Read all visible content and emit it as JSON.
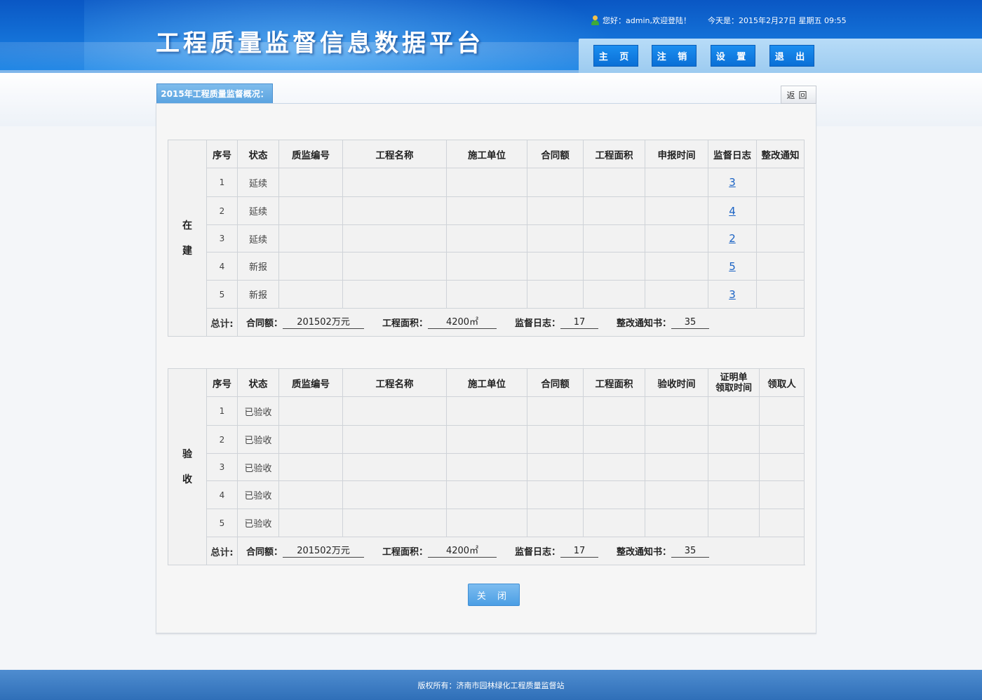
{
  "header": {
    "title": "工程质量监督信息数据平台",
    "greeting": "您好：admin,欢迎登陆！",
    "today": "今天是：2015年2月27日 星期五 09:55"
  },
  "nav": [
    {
      "label": "主 页"
    },
    {
      "label": "注 销"
    },
    {
      "label": "设 置"
    },
    {
      "label": "退 出"
    }
  ],
  "section": {
    "tab_title": "2015年工程质量监督概况：",
    "back_label": "返回"
  },
  "building": {
    "side_label_1": "在",
    "side_label_2": "建",
    "headers": [
      "序号",
      "状态",
      "质监编号",
      "工程名称",
      "施工单位",
      "合同额",
      "工程面积",
      "申报时间",
      "监督日志",
      "整改通知"
    ],
    "rows": [
      {
        "idx": "1",
        "status": "延续",
        "log": "3"
      },
      {
        "idx": "2",
        "status": "延续",
        "log": "4"
      },
      {
        "idx": "3",
        "status": "延续",
        "log": "2"
      },
      {
        "idx": "4",
        "status": "新报",
        "log": "5"
      },
      {
        "idx": "5",
        "status": "新报",
        "log": "3"
      }
    ],
    "total": {
      "label": "总计:",
      "contract_label": "合同额：",
      "contract_value": "201502万元",
      "area_label": "工程面积：",
      "area_value": "4200㎡",
      "log_label": "监督日志：",
      "log_value": "17",
      "notice_label": "整改通知书：",
      "notice_value": "35"
    }
  },
  "accepted": {
    "side_label_1": "验",
    "side_label_2": "收",
    "headers": [
      "序号",
      "状态",
      "质监编号",
      "工程名称",
      "施工单位",
      "合同额",
      "工程面积",
      "验收时间",
      "证明单",
      "领取时间",
      "领取人"
    ],
    "rows": [
      {
        "idx": "1",
        "status": "已验收"
      },
      {
        "idx": "2",
        "status": "已验收"
      },
      {
        "idx": "3",
        "status": "已验收"
      },
      {
        "idx": "4",
        "status": "已验收"
      },
      {
        "idx": "5",
        "status": "已验收"
      }
    ],
    "total": {
      "label": "总计:",
      "contract_label": "合同额：",
      "contract_value": "201502万元",
      "area_label": "工程面积：",
      "area_value": "4200㎡",
      "log_label": "监督日志：",
      "log_value": "17",
      "notice_label": "整改通知书：",
      "notice_value": "35"
    }
  },
  "close_label": "关 闭",
  "footer": {
    "copyright": "版权所有：济南市园林绿化工程质量监督站"
  },
  "colors": {
    "header_blue": "#1472d8",
    "nav_button": "#0a6fd6",
    "link": "#1a62c4",
    "footer_blue": "#3f7ec4"
  }
}
